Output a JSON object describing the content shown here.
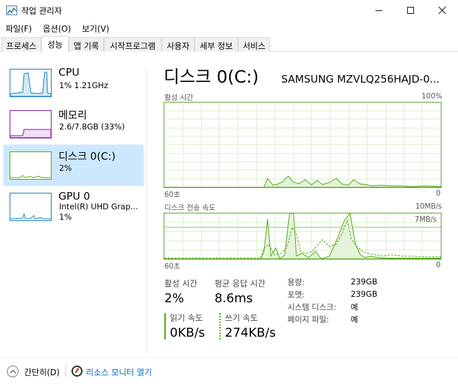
{
  "window": {
    "title": "작업 관리자",
    "icons": {
      "app": "task-manager-icon",
      "minimize": "minimize-icon",
      "maximize": "maximize-icon",
      "close": "close-icon"
    }
  },
  "menu": [
    "파일(F)",
    "옵션(O)",
    "보기(V)"
  ],
  "tabs": [
    {
      "label": "프로세스"
    },
    {
      "label": "성능",
      "active": true
    },
    {
      "label": "앱 기록"
    },
    {
      "label": "시작프로그램"
    },
    {
      "label": "사용자"
    },
    {
      "label": "세부 정보"
    },
    {
      "label": "서비스"
    }
  ],
  "sidebar": [
    {
      "name": "CPU",
      "line1": "1% 1.21GHz",
      "line2": "",
      "color": "#117dbb"
    },
    {
      "name": "메모리",
      "line1": "2.6/7.8GB (33%)",
      "line2": "",
      "color": "#8b12ae"
    },
    {
      "name": "디스크 0(C:)",
      "line1": "2%",
      "line2": "",
      "color": "#4da60c",
      "selected": true
    },
    {
      "name": "GPU 0",
      "line1": "Intel(R) UHD Grap...",
      "line2": "1%",
      "color": "#117dbb"
    }
  ],
  "main": {
    "title": "디스크 0(C:)",
    "model": "SAMSUNG MZVLQ256HAJD-0...",
    "graph1": {
      "label": "활성 시간",
      "max": "100%",
      "xleft": "60초",
      "xright": "0"
    },
    "graph2": {
      "label": "디스크 전송 속도",
      "max": "10MB/s",
      "inner": "7MB/s",
      "xleft": "60초",
      "xright": "0"
    },
    "stats": {
      "active_label": "활성 시간",
      "active_value": "2%",
      "resp_label": "평균 응답 시간",
      "resp_value": "8.6ms",
      "read_label": "읽기 속도",
      "read_value": "0KB/s",
      "write_label": "쓰기 속도",
      "write_value": "274KB/s"
    },
    "info": [
      {
        "label": "용량:",
        "value": "239GB"
      },
      {
        "label": "포맷:",
        "value": "239GB"
      },
      {
        "label": "시스템 디스크:",
        "value": "예"
      },
      {
        "label": "페이지 파일:",
        "value": "예"
      }
    ]
  },
  "footer": {
    "fewer": "간단히(D)",
    "resmon": "리소스 모니터 열기"
  },
  "colors": {
    "disk": "#4da60c",
    "cpu": "#117dbb",
    "mem": "#8b12ae",
    "select": "#cce8ff",
    "link": "#0066cc"
  }
}
